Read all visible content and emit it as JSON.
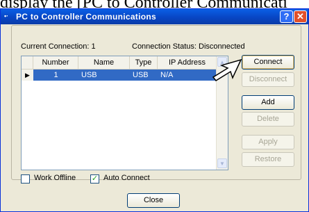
{
  "background_text": "display the [PC to Controller Communicati",
  "window": {
    "title": "PC to Controller Communications",
    "help_glyph": "?",
    "close_glyph": "✕"
  },
  "status": {
    "current_connection": "Current Connection: 1",
    "connection_status": "Connection Status: Disconnected"
  },
  "table": {
    "headers": [
      "Number",
      "Name",
      "Type",
      "IP Address"
    ],
    "rows": [
      {
        "number": "1",
        "name": "USB",
        "type": "USB",
        "ip": "N/A",
        "selected": true
      }
    ]
  },
  "buttons": {
    "connect": "Connect",
    "disconnect": "Disconnect",
    "add": "Add",
    "delete": "Delete",
    "apply": "Apply",
    "restore": "Restore",
    "close": "Close"
  },
  "checkboxes": {
    "work_offline": {
      "label": "Work Offline",
      "checked": false
    },
    "auto_connect": {
      "label": "Auto Connect",
      "checked": true
    }
  },
  "icons": {
    "title_icon": "connection-icon",
    "row_indicator": "triangle-right-icon",
    "pointer": "arrow-pointer-icon"
  },
  "colors": {
    "title_bar": "#0846c4",
    "selection": "#316ac5",
    "dialog": "#ece9d8"
  }
}
